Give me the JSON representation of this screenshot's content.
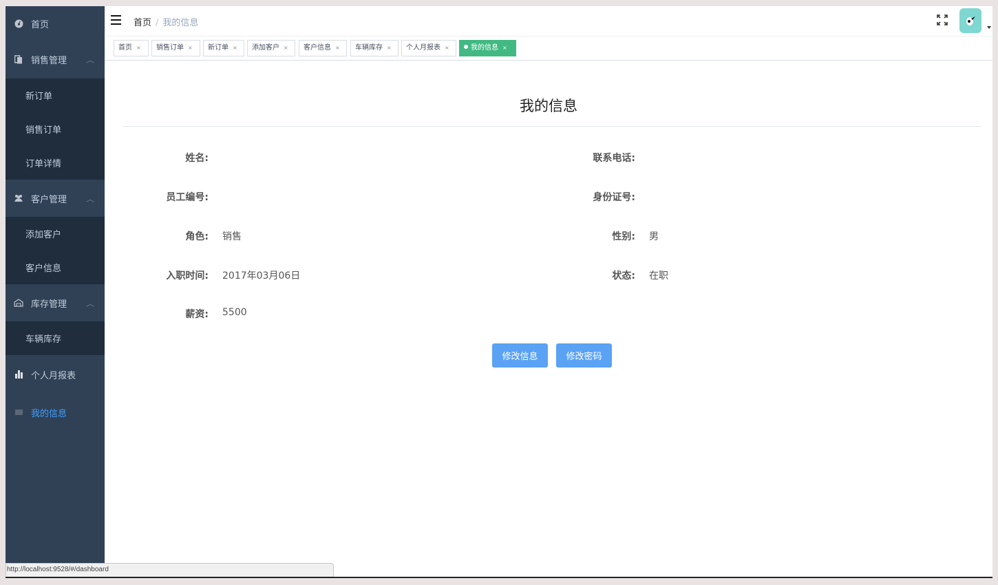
{
  "sidebar": {
    "items": [
      {
        "label": "首页",
        "icon": "dashboard-icon"
      },
      {
        "label": "销售管理",
        "icon": "document-icon"
      },
      {
        "label": "新订单"
      },
      {
        "label": "销售订单"
      },
      {
        "label": "订单详情"
      },
      {
        "label": "客户管理",
        "icon": "people-icon"
      },
      {
        "label": "添加客户"
      },
      {
        "label": "客户信息"
      },
      {
        "label": "库存管理",
        "icon": "warehouse-icon"
      },
      {
        "label": "车辆库存"
      },
      {
        "label": "个人月报表",
        "icon": "bar-chart-icon"
      },
      {
        "label": "我的信息",
        "icon": "card-icon"
      }
    ],
    "active_color": "#409eff"
  },
  "navbar": {
    "breadcrumb_home": "首页",
    "breadcrumb_sep": "/",
    "breadcrumb_current": "我的信息"
  },
  "tags": [
    {
      "label": "首页"
    },
    {
      "label": "销售订单"
    },
    {
      "label": "新订单"
    },
    {
      "label": "添加客户"
    },
    {
      "label": "客户信息"
    },
    {
      "label": "车辆库存"
    },
    {
      "label": "个人月报表"
    },
    {
      "label": "我的信息",
      "active": true
    }
  ],
  "tag_close": "×",
  "profile": {
    "title": "我的信息",
    "fields": {
      "name": {
        "label": "姓名:",
        "value": ""
      },
      "phone": {
        "label": "联系电话:",
        "value": ""
      },
      "employee_id": {
        "label": "员工编号:",
        "value": ""
      },
      "id_card": {
        "label": "身份证号:",
        "value": ""
      },
      "role": {
        "label": "角色:",
        "value": "销售"
      },
      "gender": {
        "label": "性别:",
        "value": "男"
      },
      "hire_date": {
        "label": "入职时间:",
        "value": "2017年03月06日"
      },
      "status": {
        "label": "状态:",
        "value": "在职"
      },
      "salary": {
        "label": "薪资:",
        "value": "5500"
      }
    },
    "edit_button": "修改信息",
    "password_button": "修改密码"
  },
  "statusbar": {
    "url": "http://localhost:9528/#/dashboard"
  },
  "colors": {
    "sidebar_bg": "#304156",
    "submenu_bg": "#1f2d3d",
    "tag_active": "#42b983",
    "button": "#5aa2f4"
  }
}
